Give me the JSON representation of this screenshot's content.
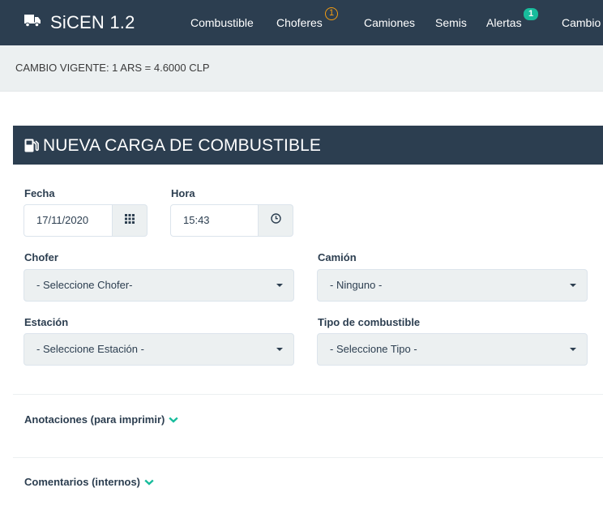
{
  "navbar": {
    "brand": "SiCEN 1.2",
    "items": [
      {
        "label": "Combustible"
      },
      {
        "label": "Choferes",
        "badge": "1"
      },
      {
        "label": "Camiones"
      },
      {
        "label": "Semis"
      },
      {
        "label": "Alertas",
        "badge": "1"
      },
      {
        "label": "Cambio"
      }
    ]
  },
  "exchange": {
    "text": "CAMBIO VIGENTE: 1 ARS = 4.6000 CLP"
  },
  "form": {
    "title": "NUEVA CARGA DE COMBUSTIBLE",
    "fecha": {
      "label": "Fecha",
      "value": "17/11/2020"
    },
    "hora": {
      "label": "Hora",
      "value": "15:43"
    },
    "chofer": {
      "label": "Chofer",
      "selected": "- Seleccione Chofer-"
    },
    "camion": {
      "label": "Camión",
      "selected": "- Ninguno -"
    },
    "estacion": {
      "label": "Estación",
      "selected": "- Seleccione Estación -"
    },
    "tipo": {
      "label": "Tipo de combustible",
      "selected": "- Seleccione Tipo -"
    },
    "anotaciones": "Anotaciones (para imprimir)",
    "comentarios": "Comentarios (internos)"
  },
  "colors": {
    "navbar": "#2c3e50",
    "accent": "#18bc9c",
    "warning": "#f39c12",
    "light": "#ecf0f1"
  },
  "icons": {
    "brand": "truck-icon",
    "title": "gas-pump-icon",
    "date": "calendar-grid-icon",
    "time": "clock-icon",
    "toggle": "chevron-down-icon"
  }
}
